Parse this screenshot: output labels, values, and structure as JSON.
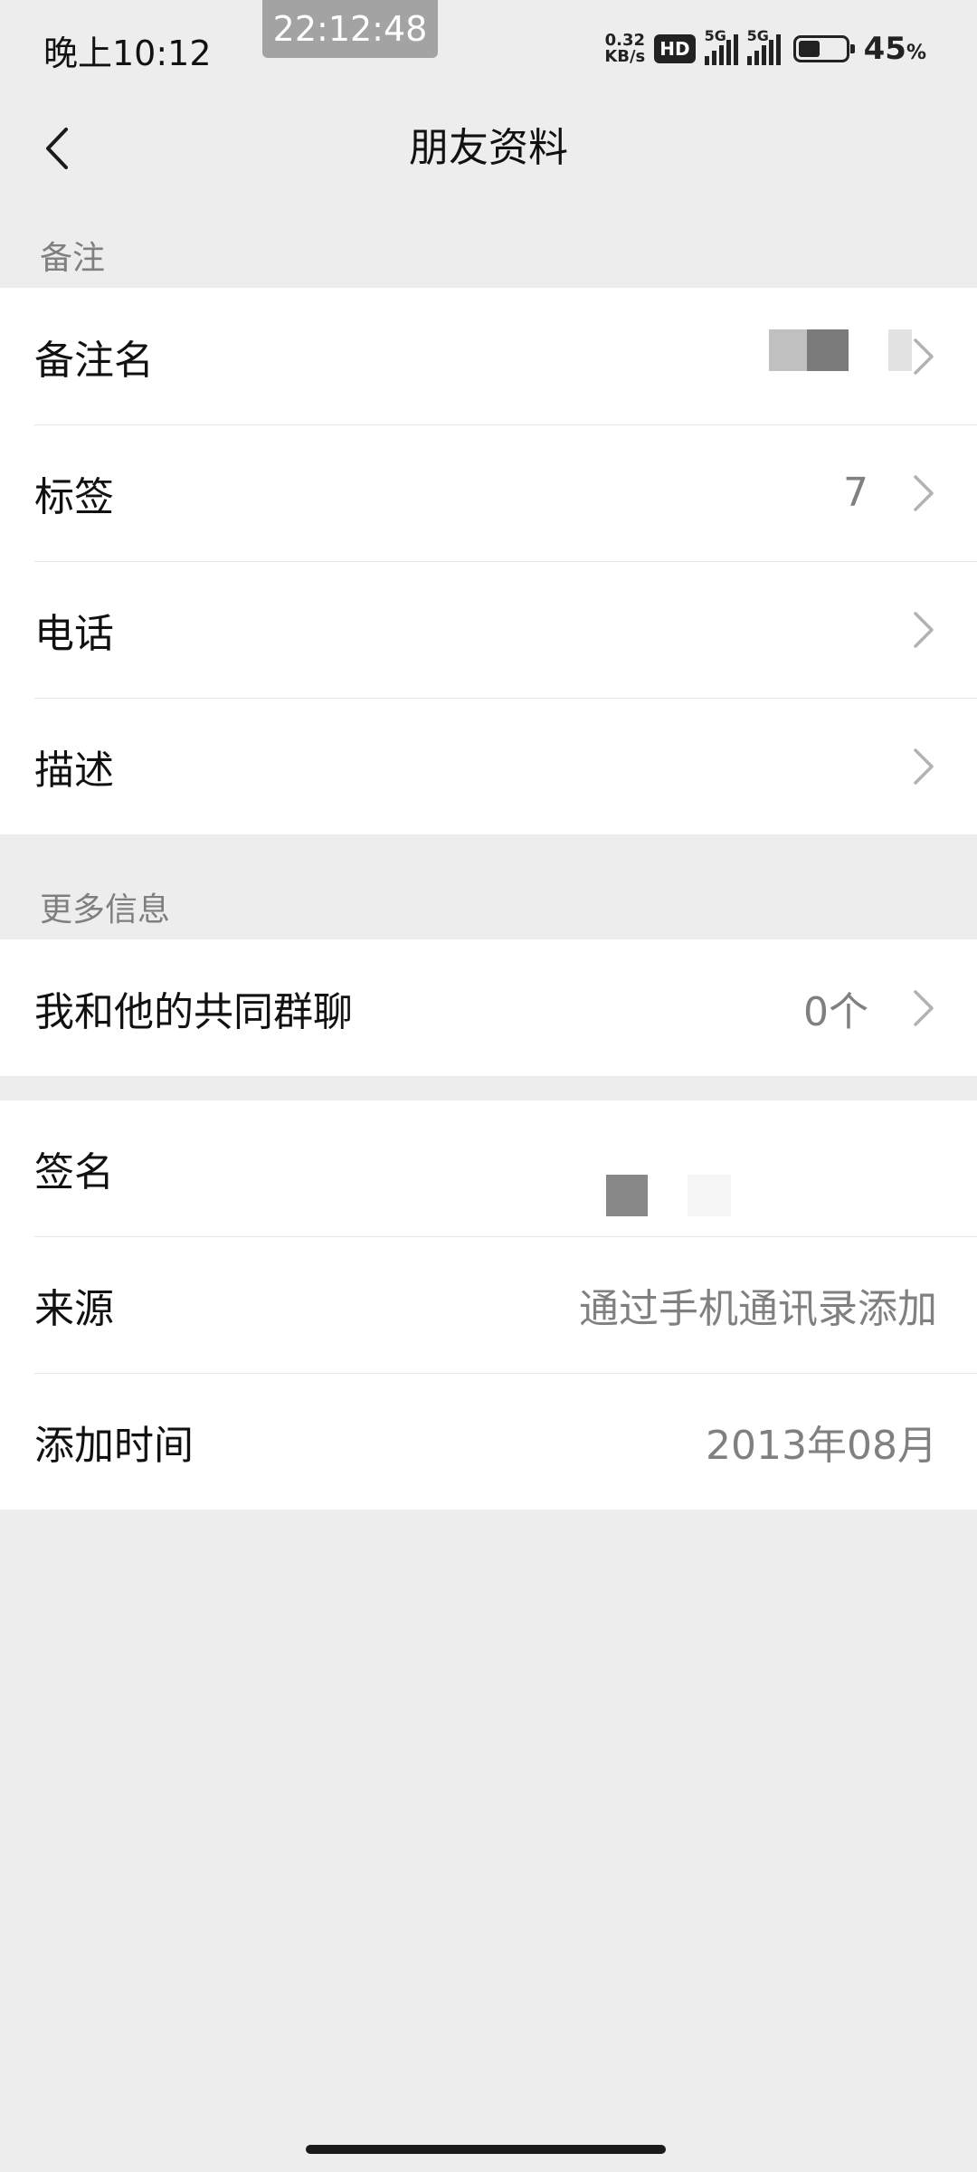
{
  "status_bar": {
    "time": "晚上10:12",
    "clock_overlay": "22:12:48",
    "speed_value": "0.32",
    "speed_unit": "KB/s",
    "hd_badge": "HD",
    "sim1_network": "5G",
    "sim2_network": "5G",
    "battery_level": 0.45,
    "battery_percent": "45",
    "battery_percent_sign": "%"
  },
  "nav": {
    "title": "朋友资料",
    "back_icon": "chevron-left-icon"
  },
  "section_remark": {
    "header": "备注",
    "rows": [
      {
        "label": "备注名",
        "value": ""
      },
      {
        "label": "标签",
        "value": "7"
      },
      {
        "label": "电话",
        "value": ""
      },
      {
        "label": "描述",
        "value": ""
      }
    ]
  },
  "section_more": {
    "header": "更多信息",
    "rows": [
      {
        "label": "我和他的共同群聊",
        "value": "0个"
      }
    ]
  },
  "section_info": {
    "rows": [
      {
        "label": "签名",
        "value": ""
      },
      {
        "label": "来源",
        "value": "通过手机通讯录添加"
      },
      {
        "label": "添加时间",
        "value": "2013年08月"
      }
    ]
  },
  "colors": {
    "background": "#ededed",
    "card": "#ffffff",
    "secondary_text": "#808080"
  }
}
